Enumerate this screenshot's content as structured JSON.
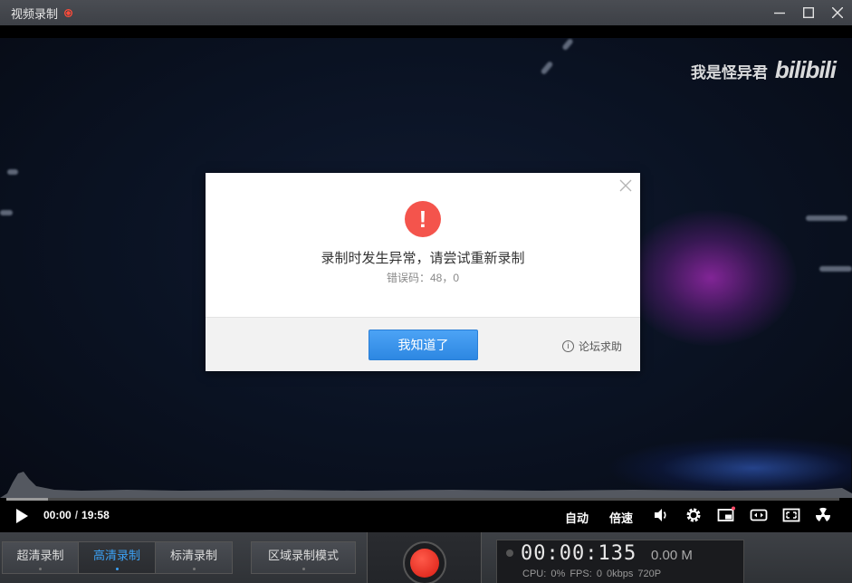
{
  "window": {
    "title": "视频录制",
    "controls": [
      "minimize",
      "maximize",
      "close"
    ]
  },
  "video": {
    "watermark_name": "我是怪异君",
    "watermark_logo": "bilibili"
  },
  "dialog": {
    "message": "录制时发生异常，请尝试重新录制",
    "error_code": "错误码：48，0",
    "ok_label": "我知道了",
    "help_label": "论坛求助"
  },
  "playback": {
    "current_time": "00:00",
    "total_time": "19:58",
    "auto_label": "自动",
    "speed_label": "倍速",
    "progress": 0.05
  },
  "toolbar": {
    "modes": [
      {
        "label": "超清录制",
        "active": false
      },
      {
        "label": "高清录制",
        "active": true
      },
      {
        "label": "标清录制",
        "active": false
      }
    ],
    "region_label": "区域录制模式"
  },
  "stats": {
    "timer": "00:00:135",
    "size": "0.00 M",
    "cpu": "CPU: 0%",
    "fps": "FPS: 0",
    "bitrate": "0kbps",
    "resolution": "720P"
  },
  "colors": {
    "accent": "#3ba2f7",
    "record": "#e8281c",
    "error": "#f4544c",
    "ok_button": "#2d87e2"
  }
}
